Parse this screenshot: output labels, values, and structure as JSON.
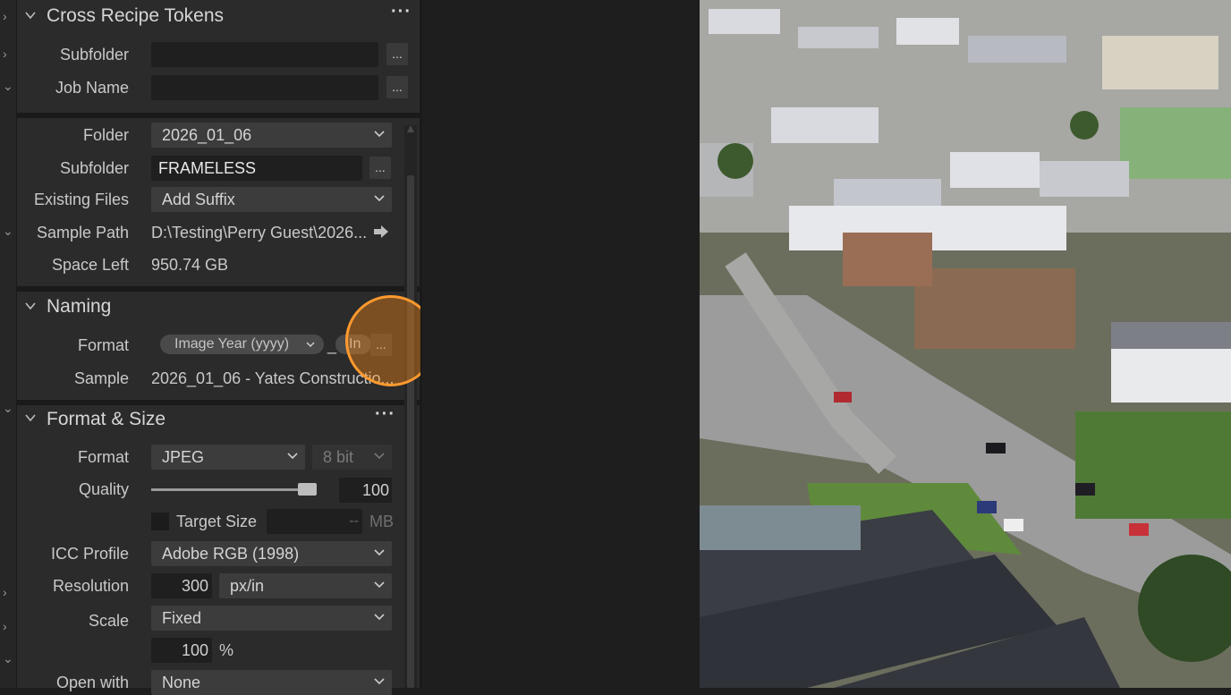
{
  "cross_recipe_tokens": {
    "title": "Cross Recipe Tokens",
    "subfolder_label": "Subfolder",
    "subfolder_value": "",
    "job_name_label": "Job Name",
    "job_name_value": "",
    "browse_label": "..."
  },
  "output_location": {
    "folder_label": "Folder",
    "folder_value": "2026_01_06",
    "subfolder_label": "Subfolder",
    "subfolder_value": "FRAMELESS",
    "browse_label": "...",
    "existing_files_label": "Existing Files",
    "existing_files_value": "Add Suffix",
    "sample_path_label": "Sample Path",
    "sample_path_value": "D:\\Testing\\Perry Guest\\2026...",
    "space_left_label": "Space Left",
    "space_left_value": "950.74 GB"
  },
  "naming": {
    "title": "Naming",
    "format_label": "Format",
    "token1": "Image Year (yyyy)",
    "separator": "_",
    "token2": "In",
    "browse_label": "...",
    "sample_label": "Sample",
    "sample_value": "2026_01_06 - Yates Constructio..."
  },
  "format_size": {
    "title": "Format & Size",
    "format_label": "Format",
    "format_value": "JPEG",
    "bit_depth_value": "8 bit",
    "quality_label": "Quality",
    "quality_value": "100",
    "quality_level": 1.0,
    "target_size_label": "Target Size",
    "target_size_value": "--",
    "target_size_unit": "MB",
    "icc_label": "ICC Profile",
    "icc_value": "Adobe RGB (1998)",
    "resolution_label": "Resolution",
    "resolution_value": "300",
    "resolution_unit": "px/in",
    "scale_label": "Scale",
    "scale_value": "Fixed",
    "scale_percent": "100",
    "percent_sign": "%",
    "open_with_label": "Open with",
    "open_with_value": "None"
  },
  "colors": {
    "panel_bg": "#2b2b2b",
    "field_bg": "#1f1f1f",
    "select_bg": "#3c3c3c",
    "cursor_highlight": "#ff9a2e"
  },
  "icons": [
    "chevron-down-icon",
    "chevron-right-icon",
    "more-options-icon",
    "arrow-right-icon"
  ]
}
